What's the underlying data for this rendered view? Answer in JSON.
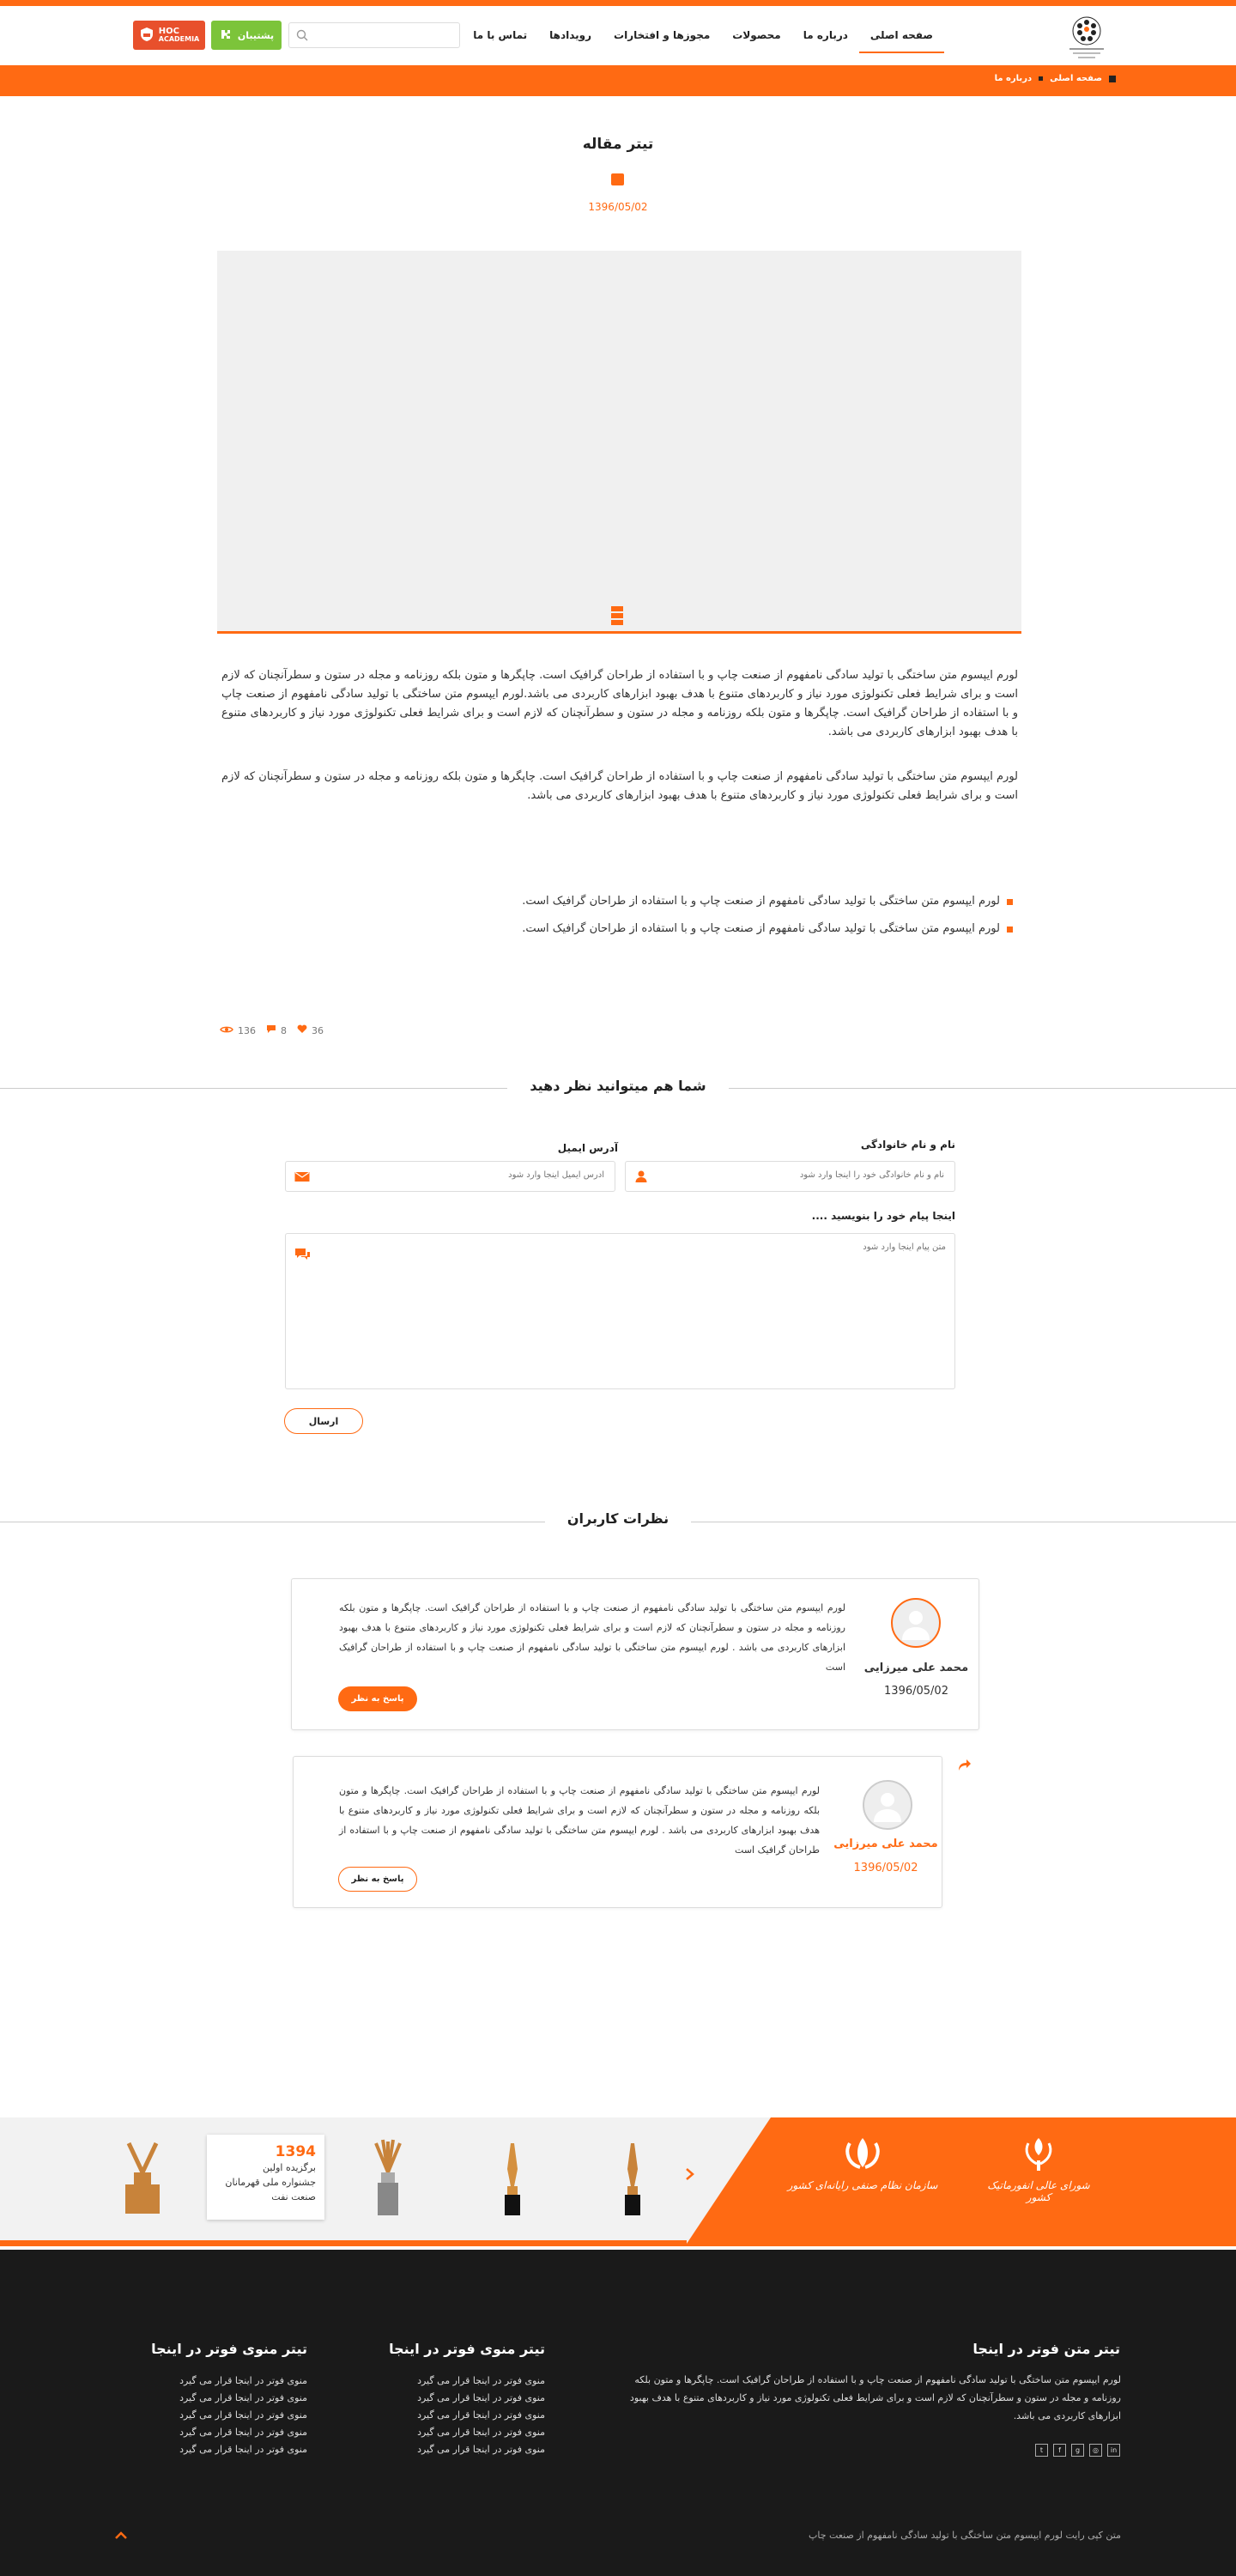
{
  "colors": {
    "accent": "#ff6a13",
    "support_green": "#7cc43a",
    "academy_red": "#e8502c",
    "footer_bg": "#1a1a1a"
  },
  "header": {
    "nav": [
      "صفحه اصلی",
      "درباره ما",
      "محصولات",
      "مجوزها و افتخارات",
      "رویدادها",
      "تماس با ما"
    ],
    "search_placeholder": "",
    "support_label": "پشتیبان",
    "academy_label_1": "HOC",
    "academy_label_2": "ACADEMIA"
  },
  "breadcrumb": [
    "صفحه اصلی",
    "درباره ما"
  ],
  "article": {
    "title": "تیتر مقاله",
    "date": "1396/05/02",
    "paragraph_1": "لورم ایپسوم متن ساختگی با تولید سادگی نامفهوم از صنعت چاپ و با استفاده از طراحان گرافیک است. چاپگرها و متون بلکه روزنامه و مجله در ستون و سطرآنچنان که لازم است و برای شرایط فعلی تکنولوژی مورد نیاز و کاربردهای متنوع با هدف بهبود ابزارهای کاربردی می باشد.لورم ایپسوم متن ساختگی با تولید سادگی نامفهوم از صنعت چاپ و با استفاده از طراحان گرافیک است. چاپگرها و متون بلکه روزنامه و مجله در ستون و سطرآنچنان که لازم است و برای شرایط فعلی تکنولوژی مورد نیاز و کاربردهای متنوع با هدف بهبود ابزارهای کاربردی می باشد.",
    "paragraph_2": "لورم ایپسوم متن ساختگی با تولید سادگی نامفهوم از صنعت چاپ و با استفاده از طراحان گرافیک است. چاپگرها و متون بلکه روزنامه و مجله در ستون و سطرآنچنان که لازم است و برای شرایط فعلی تکنولوژی مورد نیاز و کاربردهای متنوع با هدف بهبود ابزارهای کاربردی می باشد.",
    "bullets": [
      "لورم ایپسوم متن ساختگی با تولید سادگی نامفهوم از صنعت چاپ و با استفاده از طراحان گرافیک است.",
      "لورم ایپسوم متن ساختگی با تولید سادگی نامفهوم از صنعت چاپ و با استفاده از طراحان گرافیک است."
    ],
    "likes": "36",
    "comments": "8",
    "views": "136"
  },
  "comment_form": {
    "heading": "شما هم میتوانید نظر دهید",
    "name_label": "نام و نام خانوادگی",
    "name_placeholder": "نام و نام خانوادگی خود را اینجا وارد شود",
    "email_label": "آدرس ایمیل",
    "email_placeholder": "آدرس ایمیل اینجا وارد شود",
    "message_label": "اینجا پیام خود را بنویسید ....",
    "message_placeholder": "متن پیام اینجا وارد شود",
    "submit_label": "ارسال"
  },
  "comments_section": {
    "heading": "نظرات کاربران",
    "items": [
      {
        "name": "محمد علی میرزایی",
        "date": "1396/05/02",
        "text": "لورم ایپسوم متن ساختگی با تولید سادگی نامفهوم از صنعت چاپ و با استفاده از طراحان گرافیک است. چاپگرها و متون بلکه روزنامه و مجله در ستون و سطرآنچنان که لازم است و برای شرایط فعلی تکنولوژی مورد نیاز و کاربردهای متنوع با هدف بهبود ابزارهای کاربردی می باشد . لورم ایپسوم متن ساختگی با تولید سادگی نامفهوم از صنعت چاپ و با استفاده از طراحان گرافیک است",
        "reply_label": "پاسخ به نظر"
      },
      {
        "name": "محمد علی میرزایی",
        "date": "1396/05/02",
        "text": "لورم ایپسوم متن ساختگی با تولید سادگی نامفهوم از صنعت چاپ و با استفاده از طراحان گرافیک است. چاپگرها و متون بلکه روزنامه و مجله در ستون و سطرآنچنان که لازم است و برای شرایط فعلی تکنولوژی مورد نیاز و کاربردهای متنوع با هدف بهبود ابزارهای کاربردی می باشد . لورم ایپسوم متن ساختگی با تولید سادگی نامفهوم از صنعت چاپ و با استفاده از طراحان گرافیک است",
        "reply_label": "پاسخ به نظر"
      }
    ]
  },
  "sponsors": {
    "org_1": "شورای عالی انفورماتیک کشور",
    "org_2": "سازمان نظام صنفی رایانه‌ای کشور",
    "award_year": "1394",
    "award_line_1": "برگزیده اولین",
    "award_line_2": "جشنواره ملی قهرمانان",
    "award_line_3": "صنعت نفت"
  },
  "footer": {
    "about_title": "تیتر متن فوتر در اینجا",
    "about_text": "لورم ایپسوم متن ساختگی با تولید سادگی نامفهوم از صنعت چاپ و با استفاده از طراحان گرافیک است. چاپگرها و متون بلکه روزنامه و مجله در ستون و سطرآنچنان که لازم است و برای شرایط فعلی تکنولوژی مورد نیاز و کاربردهای متنوع با هدف بهبود ابزارهای کاربردی می باشد.",
    "menu_1_title": "تیتر منوی فوتر در اینجا",
    "menu_2_title": "تیتر منوی فوتر در اینجا",
    "menu_1": [
      "منوی فوتر در اینجا قرار می گیرد",
      "منوی فوتر در اینجا قرار می گیرد",
      "منوی فوتر در اینجا قرار می گیرد",
      "منوی فوتر در اینجا قرار می گیرد",
      "منوی فوتر در اینجا قرار می گیرد"
    ],
    "menu_2": [
      "منوی فوتر در اینجا قرار می گیرد",
      "منوی فوتر در اینجا قرار می گیرد",
      "منوی فوتر در اینجا قرار می گیرد",
      "منوی فوتر در اینجا قرار می گیرد",
      "منوی فوتر در اینجا قرار می گیرد"
    ],
    "social_icons": [
      "linkedin-icon",
      "instagram-icon",
      "google-plus-icon",
      "facebook-icon",
      "twitter-icon"
    ],
    "copyright": "متن کپی رایت لورم ایپسوم متن ساختگی با تولید سادگی نامفهوم از صنعت چاپ"
  }
}
